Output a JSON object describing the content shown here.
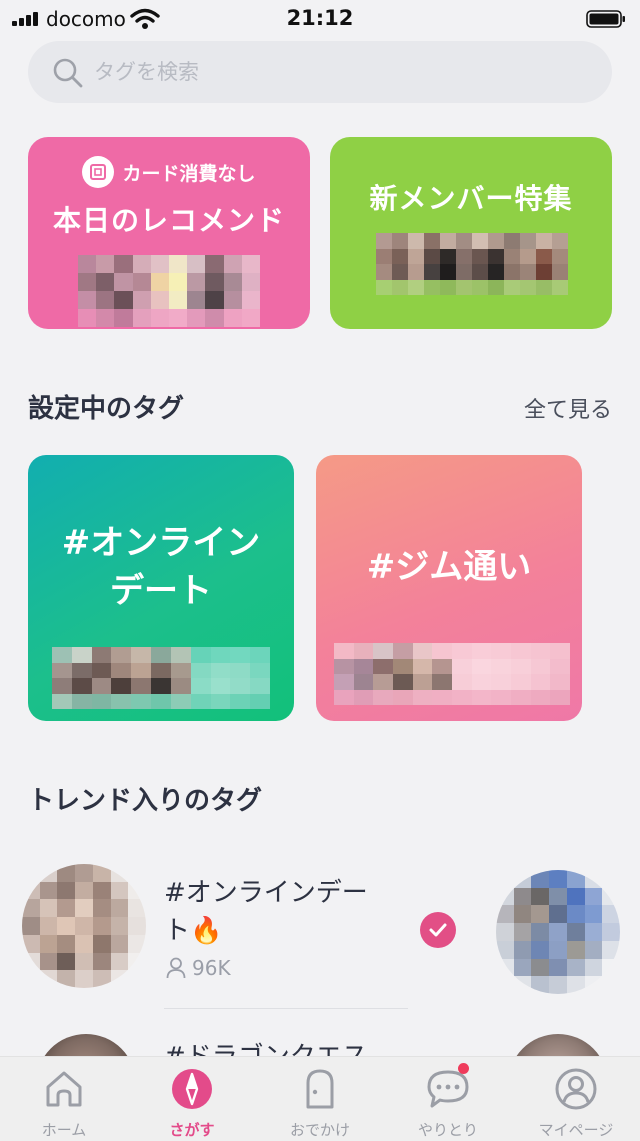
{
  "status_bar": {
    "carrier": "docomo",
    "time": "21:12"
  },
  "search": {
    "placeholder": "タグを検索"
  },
  "features": [
    {
      "badge": "カード消費なし",
      "title": "本日のレコメンド",
      "color": "#ef6aa6"
    },
    {
      "title": "新メンバー特集",
      "color": "#8fd045"
    }
  ],
  "my_tags": {
    "title": "設定中のタグ",
    "see_all": "全て見る",
    "cards": [
      {
        "line1": "#オンライン",
        "line2": "デート"
      },
      {
        "line1": "#ジム通い"
      }
    ]
  },
  "trend": {
    "title": "トレンド入りのタグ",
    "items": [
      {
        "name_line1": "#オンラインデー",
        "name_line2": "ト🔥",
        "members": "96K",
        "checked": true
      },
      {
        "name_line1": "#ドラゴンクエス"
      }
    ]
  },
  "tab_bar": {
    "tabs": [
      {
        "label": "ホーム",
        "icon": "home-icon"
      },
      {
        "label": "さがす",
        "icon": "compass-icon",
        "active": true
      },
      {
        "label": "おでかけ",
        "icon": "door-icon"
      },
      {
        "label": "やりとり",
        "icon": "chat-bubble-icon",
        "badge": true
      },
      {
        "label": "マイページ",
        "icon": "profile-icon"
      }
    ]
  },
  "colors": {
    "accent": "#e34b8a",
    "background": "#f2f2f4"
  }
}
